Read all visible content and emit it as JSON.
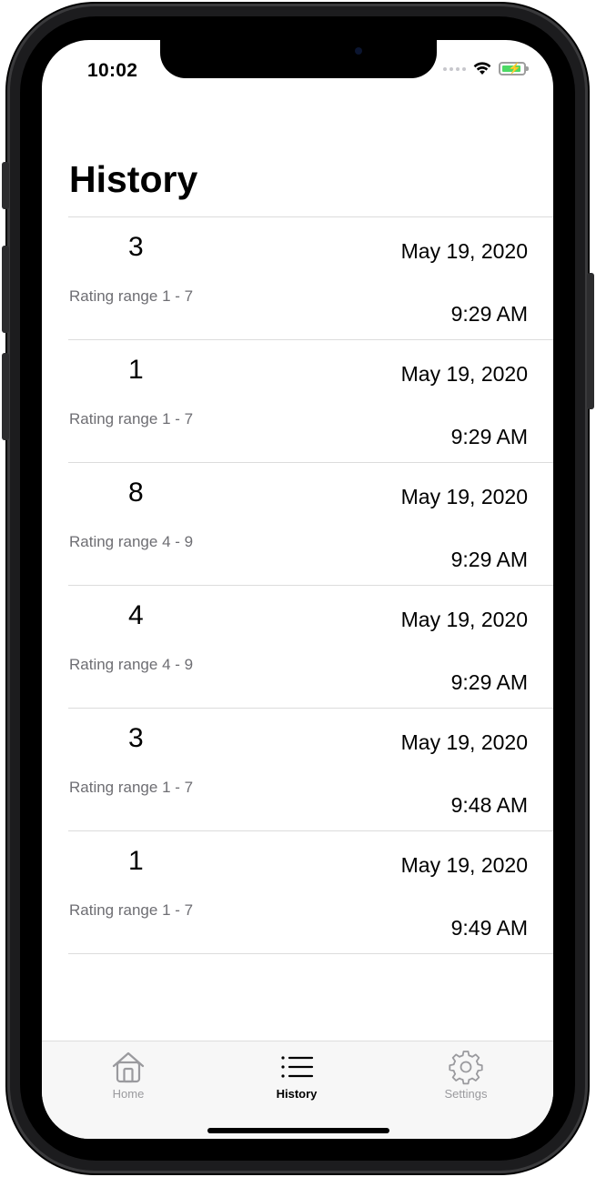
{
  "status_bar": {
    "time": "10:02"
  },
  "page": {
    "title": "History"
  },
  "history": [
    {
      "rating": "3",
      "range": "Rating range 1 - 7",
      "date": "May 19, 2020",
      "time": "9:29 AM"
    },
    {
      "rating": "1",
      "range": "Rating range 1 - 7",
      "date": "May 19, 2020",
      "time": "9:29 AM"
    },
    {
      "rating": "8",
      "range": "Rating range 4 - 9",
      "date": "May 19, 2020",
      "time": "9:29 AM"
    },
    {
      "rating": "4",
      "range": "Rating range 4 - 9",
      "date": "May 19, 2020",
      "time": "9:29 AM"
    },
    {
      "rating": "3",
      "range": "Rating range 1 - 7",
      "date": "May 19, 2020",
      "time": "9:48 AM"
    },
    {
      "rating": "1",
      "range": "Rating range 1 - 7",
      "date": "May 19, 2020",
      "time": "9:49 AM"
    }
  ],
  "tab_bar": {
    "tabs": [
      {
        "label": "Home",
        "icon": "home-icon",
        "selected": false
      },
      {
        "label": "History",
        "icon": "list-icon",
        "selected": true
      },
      {
        "label": "Settings",
        "icon": "gear-icon",
        "selected": false
      }
    ]
  },
  "colors": {
    "battery": "#4cd964",
    "secondary_text": "#6e6e73",
    "inactive_tab": "#9a9a9e"
  }
}
